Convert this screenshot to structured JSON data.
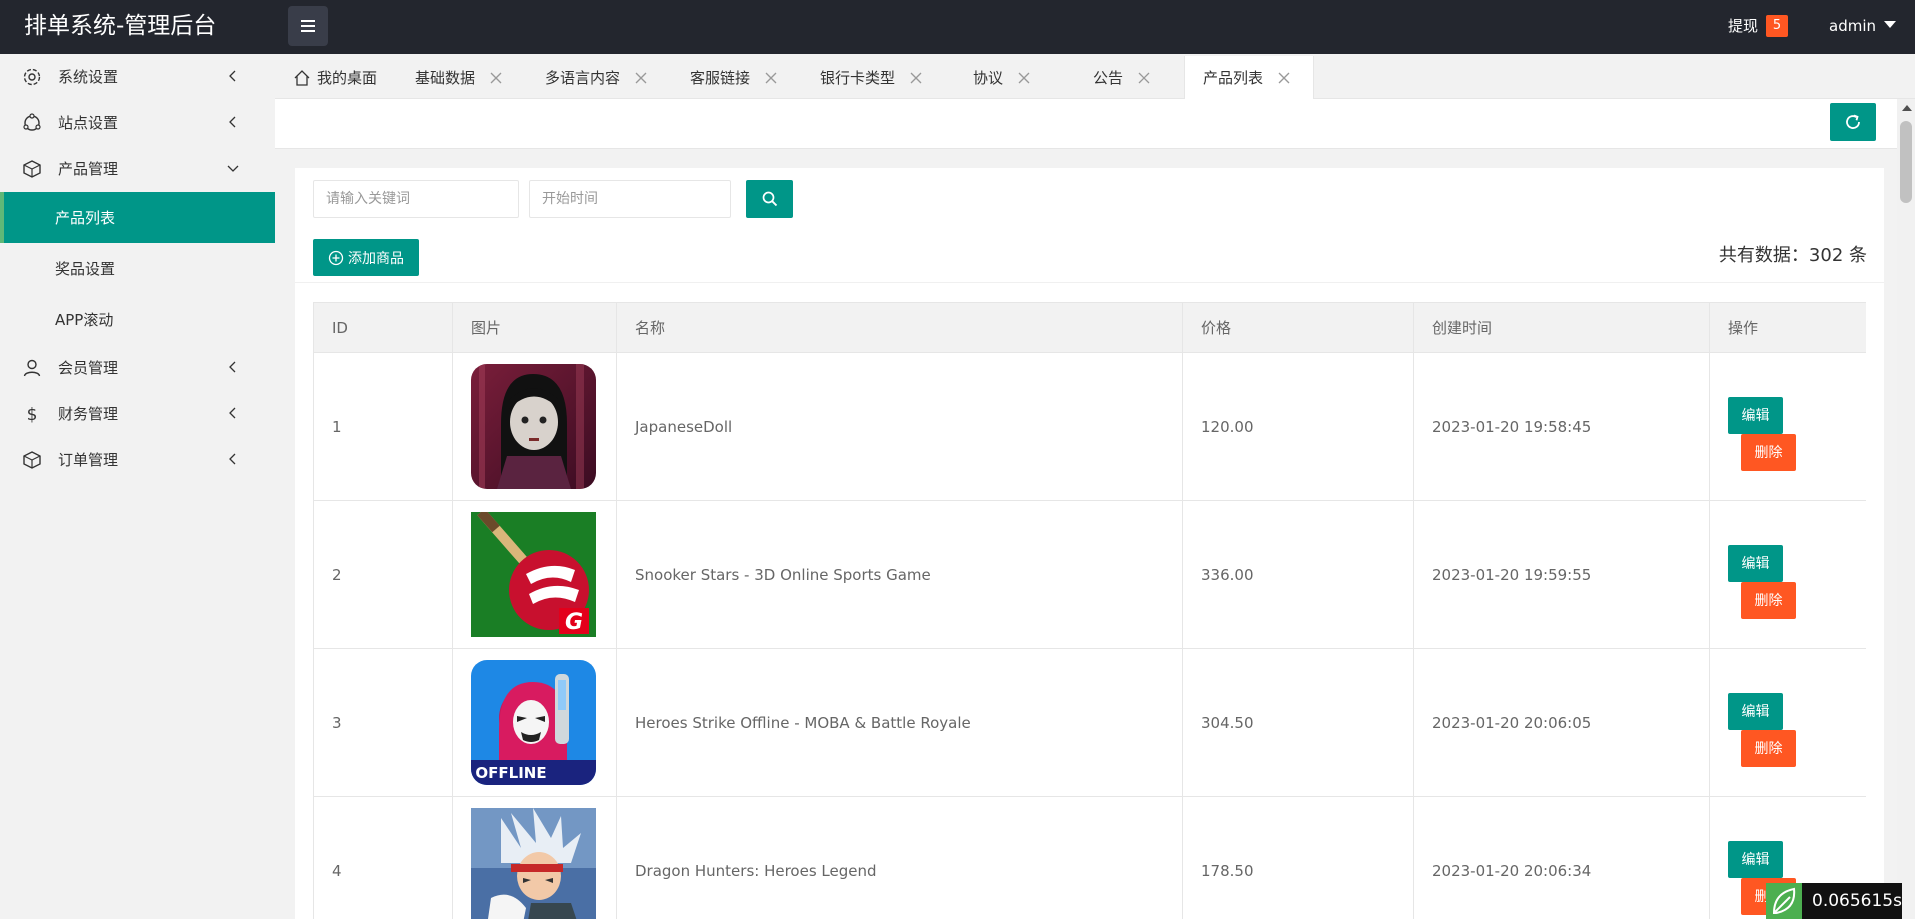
{
  "header": {
    "title": "排单系统-管理后台",
    "withdraw_label": "提现",
    "withdraw_count": "5",
    "user": "admin"
  },
  "sidebar": {
    "items": [
      {
        "label": "系统设置",
        "icon": "gear-icon"
      },
      {
        "label": "站点设置",
        "icon": "site-icon"
      },
      {
        "label": "产品管理",
        "icon": "product-icon"
      },
      {
        "label": "会员管理",
        "icon": "user-icon"
      },
      {
        "label": "财务管理",
        "icon": "dollar-icon"
      },
      {
        "label": "订单管理",
        "icon": "order-icon"
      }
    ],
    "sub_items": [
      {
        "label": "产品列表",
        "active": true
      },
      {
        "label": "奖品设置"
      },
      {
        "label": "APP滚动"
      }
    ]
  },
  "tabs": [
    {
      "label": "我的桌面"
    },
    {
      "label": "基础数据"
    },
    {
      "label": "多语言内容"
    },
    {
      "label": "客服链接"
    },
    {
      "label": "银行卡类型"
    },
    {
      "label": "协议"
    },
    {
      "label": "公告"
    },
    {
      "label": "产品列表",
      "active": true
    }
  ],
  "filters": {
    "keyword_placeholder": "请输入关键词",
    "date_placeholder": "开始时间"
  },
  "add_button": "添加商品",
  "total_text": "共有数据：302 条",
  "table": {
    "columns": [
      "ID",
      "图片",
      "名称",
      "价格",
      "创建时间",
      "操作"
    ],
    "edit_label": "编辑",
    "delete_label": "删除",
    "rows": [
      {
        "id": "1",
        "name": "JapaneseDoll",
        "price": "120.00",
        "created": "2023-01-20 19:58:45"
      },
      {
        "id": "2",
        "name": "Snooker Stars - 3D Online Sports Game",
        "price": "336.00",
        "created": "2023-01-20 19:59:55"
      },
      {
        "id": "3",
        "name": "Heroes Strike Offline - MOBA & Battle Royale",
        "price": "304.50",
        "created": "2023-01-20 20:06:05"
      },
      {
        "id": "4",
        "name": "Dragon Hunters: Heroes Legend",
        "price": "178.50",
        "created": "2023-01-20 20:06:34"
      }
    ]
  },
  "timer": "0.065615s",
  "colors": {
    "header_bg": "#23262e",
    "accent": "#009688",
    "danger": "#ff5722"
  }
}
